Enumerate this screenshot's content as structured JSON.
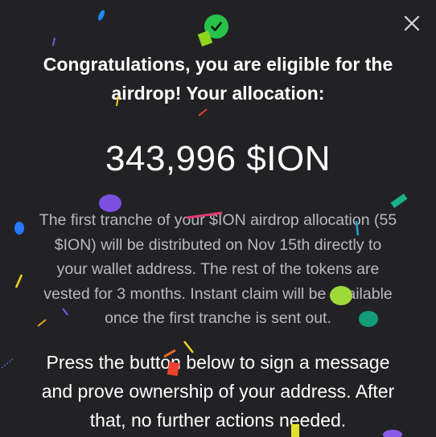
{
  "modal": {
    "heading_line1": "Congratulations, you are eligible for the",
    "heading_line2": "airdrop! Your allocation:",
    "allocation": "343,996 $ION",
    "info_lines": [
      "The first tranche of your $ION airdrop allocation (55",
      "$ION) will be distributed on Nov 15th directly to",
      "your wallet address. The rest of the tokens are",
      "vested for 3 months. Instant claim will be available",
      "once the first tranche is sent out."
    ],
    "instruction_lines": [
      "Press the button below to sign a message",
      "and prove ownership of your address. After",
      "that, no further actions needed."
    ]
  },
  "icons": {
    "close": "close-icon",
    "success": "check-circle-icon"
  },
  "colors": {
    "background": "#222225",
    "success_green": "#27c24a",
    "info_text": "#b9b9bf"
  }
}
